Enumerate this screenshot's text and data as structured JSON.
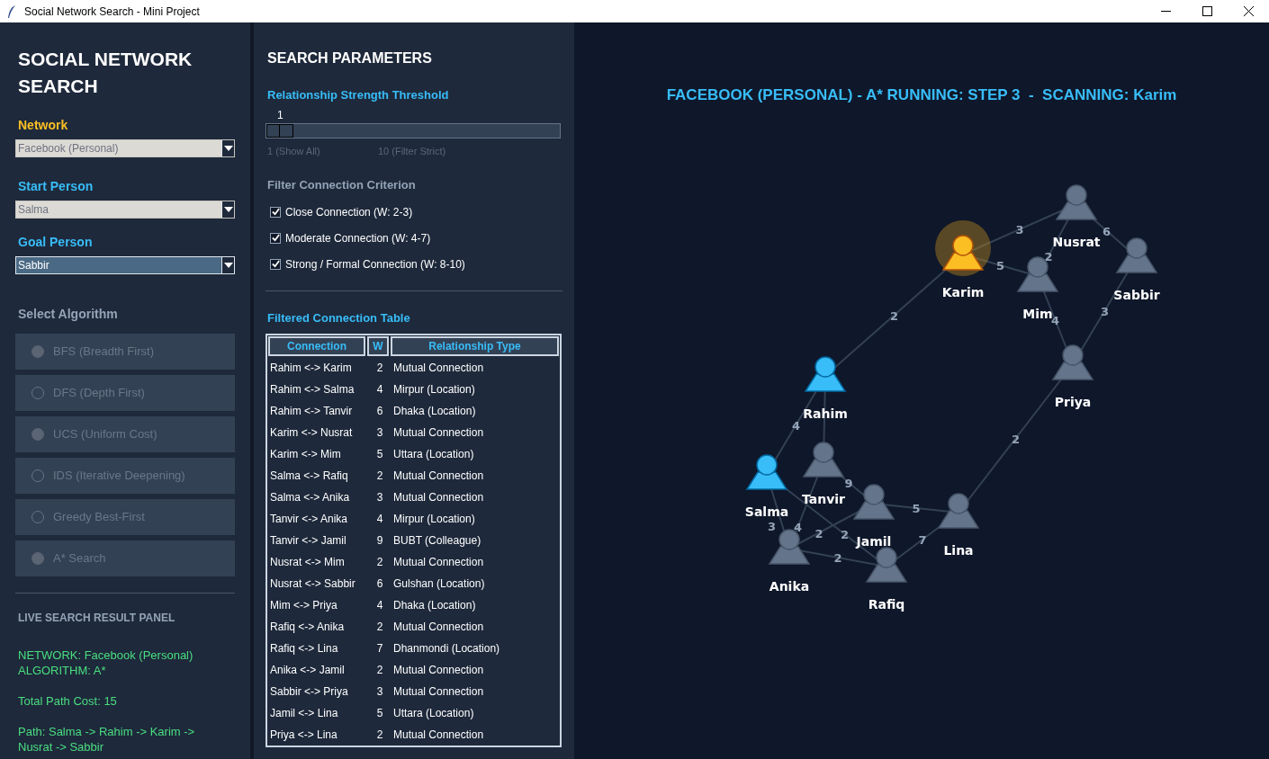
{
  "window": {
    "title": "Social Network Search - Mini Project"
  },
  "sidebar": {
    "title": "SOCIAL NETWORK SEARCH",
    "dropdowns": [
      {
        "label": "Network",
        "color": "#fbbf24",
        "value": "Facebook (Personal)",
        "disabled": true
      },
      {
        "label": "Start Person",
        "color": "#38bdf8",
        "value": "Salma",
        "disabled": true
      },
      {
        "label": "Goal Person",
        "color": "#38bdf8",
        "value": "Sabbir",
        "disabled": false
      }
    ],
    "algorithm_heading": "Select Algorithm",
    "algorithms": [
      {
        "label": "BFS (Breadth First)",
        "filled": true
      },
      {
        "label": "DFS (Depth First)",
        "filled": false
      },
      {
        "label": "UCS (Uniform Cost)",
        "filled": true
      },
      {
        "label": "IDS (Iterative Deepening)",
        "filled": false
      },
      {
        "label": "Greedy Best-First",
        "filled": false
      },
      {
        "label": "A* Search",
        "filled": true
      }
    ],
    "result_heading": "LIVE SEARCH RESULT PANEL",
    "result_lines": [
      [
        "NETWORK: Facebook (Personal)",
        "ALGORITHM: A*"
      ],
      [
        "Total Path Cost: 15"
      ],
      [
        "Path: Salma -> Rahim -> Karim -> Nusrat -> Sabbir"
      ]
    ]
  },
  "parameters": {
    "title": "SEARCH PARAMETERS",
    "slider": {
      "label": "Relationship Strength Threshold",
      "value": "1",
      "level": 0,
      "min_label": "1 (Show All)",
      "max_label": "10 (Filter Strict)"
    },
    "filter_heading": "Filter Connection Criterion",
    "filters": [
      {
        "label": "Close Connection (W: 2-3)",
        "checked": true
      },
      {
        "label": "Moderate Connection (W: 4-7)",
        "checked": true
      },
      {
        "label": "Strong / Formal Connection (W: 8-10)",
        "checked": true
      }
    ],
    "table": {
      "title": "Filtered Connection Table",
      "columns": [
        "Connection",
        "W",
        "Relationship Type"
      ],
      "rows": [
        [
          "Rahim <-> Karim",
          "2",
          "Mutual Connection"
        ],
        [
          "Rahim <-> Salma",
          "4",
          "Mirpur (Location)"
        ],
        [
          "Rahim <-> Tanvir",
          "6",
          "Dhaka (Location)"
        ],
        [
          "Karim <-> Nusrat",
          "3",
          "Mutual Connection"
        ],
        [
          "Karim <-> Mim",
          "5",
          "Uttara (Location)"
        ],
        [
          "Salma <-> Rafiq",
          "2",
          "Mutual Connection"
        ],
        [
          "Salma <-> Anika",
          "3",
          "Mutual Connection"
        ],
        [
          "Tanvir <-> Anika",
          "4",
          "Mirpur (Location)"
        ],
        [
          "Tanvir <-> Jamil",
          "9",
          "BUBT (Colleague)"
        ],
        [
          "Nusrat <-> Mim",
          "2",
          "Mutual Connection"
        ],
        [
          "Nusrat <-> Sabbir",
          "6",
          "Gulshan (Location)"
        ],
        [
          "Mim <-> Priya",
          "4",
          "Dhaka (Location)"
        ],
        [
          "Rafiq <-> Anika",
          "2",
          "Mutual Connection"
        ],
        [
          "Rafiq <-> Lina",
          "7",
          "Dhanmondi (Location)"
        ],
        [
          "Anika <-> Jamil",
          "2",
          "Mutual Connection"
        ],
        [
          "Sabbir <-> Priya",
          "3",
          "Mutual Connection"
        ],
        [
          "Jamil <-> Lina",
          "5",
          "Uttara (Location)"
        ],
        [
          "Priya <-> Lina",
          "2",
          "Mutual Connection"
        ]
      ]
    }
  },
  "graph": {
    "heading": "FACEBOOK (PERSONAL) - A* RUNNING: STEP 3  -  SCANNING: Karim",
    "nodes": [
      {
        "name": "Karim",
        "kind": "current"
      },
      {
        "name": "Nusrat",
        "kind": "unvisited"
      },
      {
        "name": "Sabbir",
        "kind": "unvisited"
      },
      {
        "name": "Mim",
        "kind": "unvisited"
      },
      {
        "name": "Priya",
        "kind": "unvisited"
      },
      {
        "name": "Rahim",
        "kind": "visited"
      },
      {
        "name": "Salma",
        "kind": "visited"
      },
      {
        "name": "Tanvir",
        "kind": "unvisited"
      },
      {
        "name": "Jamil",
        "kind": "unvisited"
      },
      {
        "name": "Lina",
        "kind": "unvisited"
      },
      {
        "name": "Anika",
        "kind": "unvisited"
      },
      {
        "name": "Rafiq",
        "kind": "unvisited"
      }
    ],
    "edge_weights": [
      "3",
      "5",
      "2",
      "6",
      "3",
      "4",
      "2",
      "4",
      "2",
      "3",
      "2",
      "4",
      "9",
      "5",
      "7",
      "2",
      "2"
    ]
  }
}
